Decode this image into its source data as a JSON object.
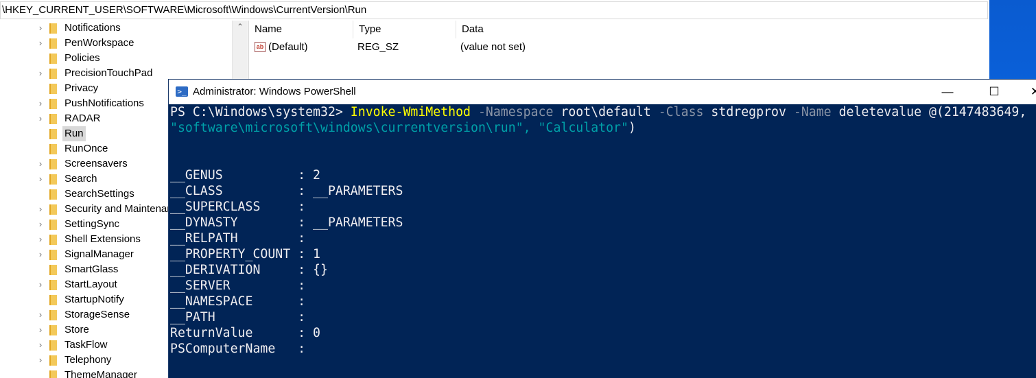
{
  "regedit": {
    "address": "\\HKEY_CURRENT_USER\\SOFTWARE\\Microsoft\\Windows\\CurrentVersion\\Run",
    "tree_items": [
      {
        "label": "Notifications",
        "expandable": true
      },
      {
        "label": "PenWorkspace",
        "expandable": true
      },
      {
        "label": "Policies",
        "expandable": false
      },
      {
        "label": "PrecisionTouchPad",
        "expandable": true
      },
      {
        "label": "Privacy",
        "expandable": false
      },
      {
        "label": "PushNotifications",
        "expandable": true
      },
      {
        "label": "RADAR",
        "expandable": true
      },
      {
        "label": "Run",
        "expandable": false,
        "selected": true
      },
      {
        "label": "RunOnce",
        "expandable": false
      },
      {
        "label": "Screensavers",
        "expandable": true
      },
      {
        "label": "Search",
        "expandable": true
      },
      {
        "label": "SearchSettings",
        "expandable": false
      },
      {
        "label": "Security and Maintenance",
        "expandable": true
      },
      {
        "label": "SettingSync",
        "expandable": true
      },
      {
        "label": "Shell Extensions",
        "expandable": true
      },
      {
        "label": "SignalManager",
        "expandable": true
      },
      {
        "label": "SmartGlass",
        "expandable": false
      },
      {
        "label": "StartLayout",
        "expandable": true
      },
      {
        "label": "StartupNotify",
        "expandable": false
      },
      {
        "label": "StorageSense",
        "expandable": true
      },
      {
        "label": "Store",
        "expandable": true
      },
      {
        "label": "TaskFlow",
        "expandable": true
      },
      {
        "label": "Telephony",
        "expandable": true
      },
      {
        "label": "ThemeManager",
        "expandable": false
      }
    ],
    "columns": {
      "name": "Name",
      "type": "Type",
      "data": "Data"
    },
    "values": [
      {
        "name": "(Default)",
        "type": "REG_SZ",
        "data": "(value not set)",
        "icon": "string-value-icon"
      }
    ]
  },
  "powershell": {
    "title": "Administrator: Windows PowerShell",
    "buttons": {
      "minimize": "—",
      "maximize": "☐",
      "close": "✕"
    },
    "prompt": "PS C:\\Windows\\system32> ",
    "command": {
      "cmdlet": "Invoke-WmiMethod",
      "p1": "-Namespace",
      "v1": "root\\default",
      "p2": "-Class",
      "v2": "stdregprov",
      "p3": "-Name",
      "v3": "deletevalue",
      "v4": "@(2147483649,",
      "line2": "\"software\\microsoft\\windows\\currentversion\\run\", \"Calculator\"",
      "line2_end": ")"
    },
    "output": [
      {
        "name": "__GENUS",
        "value": "2"
      },
      {
        "name": "__CLASS",
        "value": "__PARAMETERS"
      },
      {
        "name": "__SUPERCLASS",
        "value": ""
      },
      {
        "name": "__DYNASTY",
        "value": "__PARAMETERS"
      },
      {
        "name": "__RELPATH",
        "value": ""
      },
      {
        "name": "__PROPERTY_COUNT",
        "value": "1"
      },
      {
        "name": "__DERIVATION",
        "value": "{}"
      },
      {
        "name": "__SERVER",
        "value": ""
      },
      {
        "name": "__NAMESPACE",
        "value": ""
      },
      {
        "name": "__PATH",
        "value": ""
      },
      {
        "name": "ReturnValue",
        "value": "0"
      },
      {
        "name": "PSComputerName",
        "value": ""
      }
    ],
    "colors": {
      "background": "#012456",
      "cmdlet": "#ffff00",
      "parameter": "#8a94a6",
      "string": "#00a0a8"
    }
  }
}
